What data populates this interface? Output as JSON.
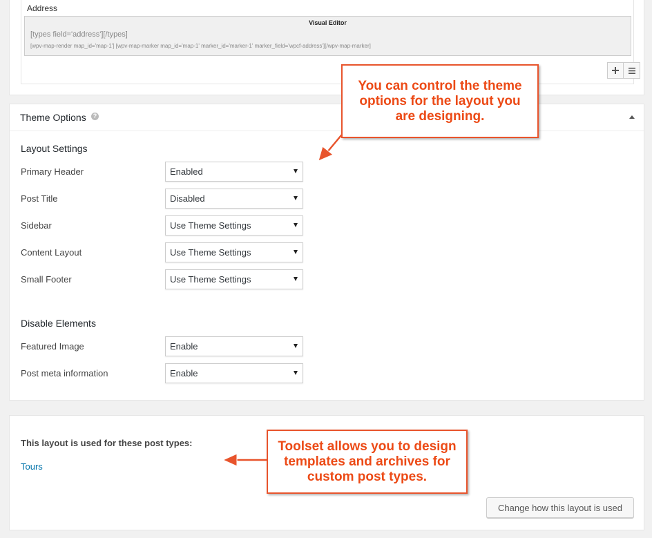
{
  "address": {
    "label": "Address",
    "editor_title": "Visual Editor",
    "shortcode_1": "[types field='address'][/types]",
    "shortcode_2": "[wpv-map-render map_id='map-1'] [wpv-map-marker map_id='map-1' marker_id='marker-1' marker_field='wpcf-address'][/wpv-map-marker]",
    "toolbar": {
      "add_icon": "plus-icon",
      "menu_icon": "menu-icon"
    }
  },
  "theme_options": {
    "title": "Theme Options",
    "help_icon": "question-icon",
    "collapse_icon": "triangle-up-icon",
    "layout_settings": {
      "title": "Layout Settings",
      "fields": [
        {
          "label": "Primary Header",
          "value": "Enabled"
        },
        {
          "label": "Post Title",
          "value": "Disabled"
        },
        {
          "label": "Sidebar",
          "value": "Use Theme Settings"
        },
        {
          "label": "Content Layout",
          "value": "Use Theme Settings"
        },
        {
          "label": "Small Footer",
          "value": "Use Theme Settings"
        }
      ]
    },
    "disable_elements": {
      "title": "Disable Elements",
      "fields": [
        {
          "label": "Featured Image",
          "value": "Enable"
        },
        {
          "label": "Post meta information",
          "value": "Enable"
        }
      ]
    }
  },
  "post_types": {
    "title": "This layout is used for these post types:",
    "items": [
      "Tours"
    ],
    "change_button": "Change how this layout is used"
  },
  "callouts": {
    "theme": "You can control the theme options for the layout you are designing.",
    "toolset": "Toolset allows you to design templates and archives for custom post types."
  },
  "colors": {
    "callout": "#e8542c",
    "link": "#0073aa"
  }
}
